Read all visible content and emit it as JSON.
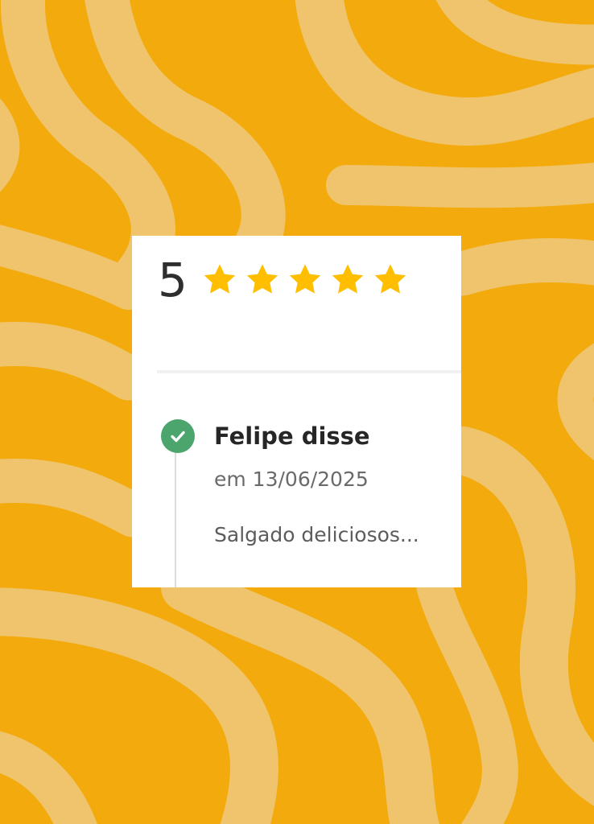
{
  "rating": {
    "score": "5",
    "stars_filled": 5,
    "stars_total": 5,
    "star_color": "#FFBF00"
  },
  "review": {
    "author_line": "Felipe disse",
    "date_line": "em 13/06/2025",
    "text": "Salgado deliciosos...",
    "verified_color": "#4BA56C"
  },
  "theme": {
    "background_color": "#F2AA0C",
    "swirl_color": "#F0C46C"
  }
}
